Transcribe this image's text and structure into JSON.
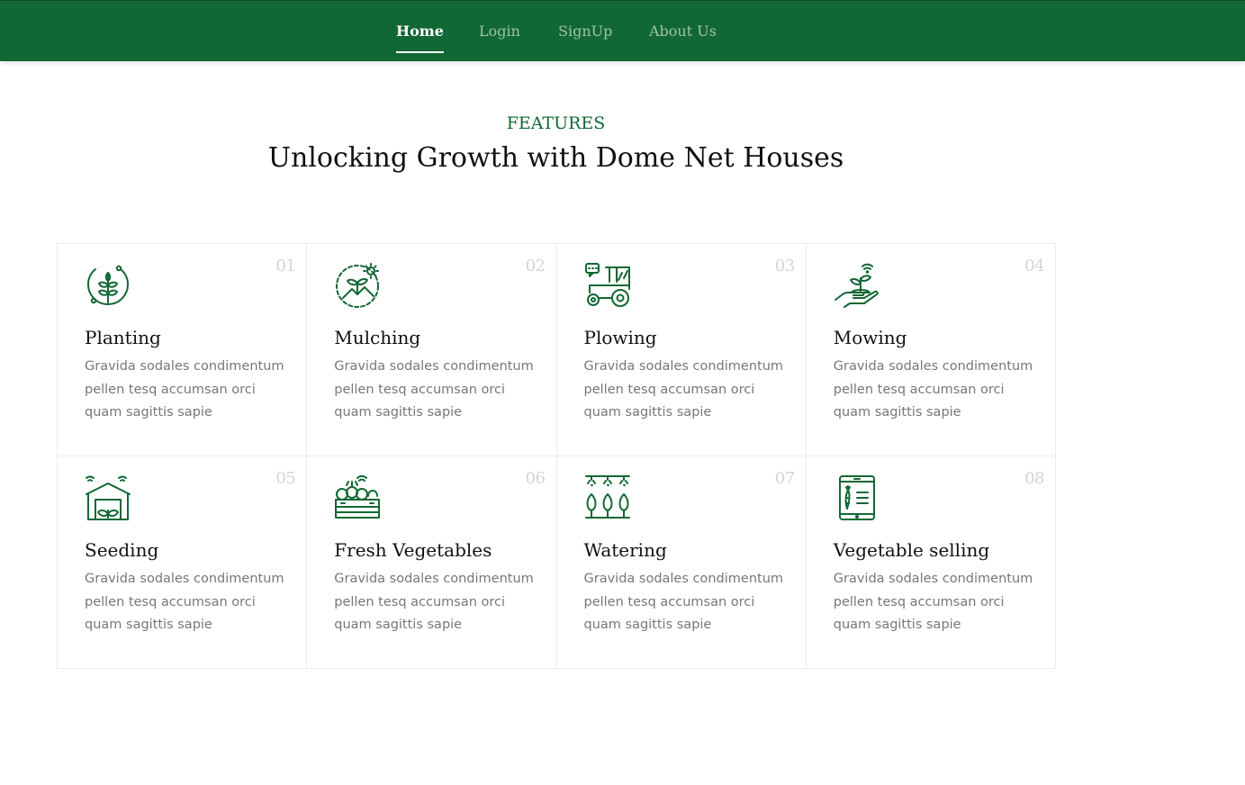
{
  "nav": {
    "home": "Home",
    "login": "Login",
    "signup": "SignUp",
    "about": "About Us",
    "active": "home"
  },
  "section": {
    "eyebrow": "FEATURES",
    "headline": "Unlocking Growth with Dome Net Houses"
  },
  "colors": {
    "brand_green": "#126835",
    "nav_link_inactive": "#9fc3a8",
    "title_text": "#111111",
    "body_text": "#777777",
    "number_text": "#d4d4d4"
  },
  "features": [
    {
      "number": "01",
      "title": "Planting",
      "icon": "plant-circle-icon",
      "description": "Gravida sodales condimentum pellen tesq accumsan orci quam sagittis sapie"
    },
    {
      "number": "02",
      "title": "Mulching",
      "icon": "seedling-sun-icon",
      "description": "Gravida sodales condimentum pellen tesq accumsan orci quam sagittis sapie"
    },
    {
      "number": "03",
      "title": "Plowing",
      "icon": "tractor-icon",
      "description": "Gravida sodales condimentum pellen tesq accumsan orci quam sagittis sapie"
    },
    {
      "number": "04",
      "title": "Mowing",
      "icon": "hand-sprout-icon",
      "description": "Gravida sodales condimentum pellen tesq accumsan orci quam sagittis sapie"
    },
    {
      "number": "05",
      "title": "Seeding",
      "icon": "greenhouse-icon",
      "description": "Gravida sodales condimentum pellen tesq accumsan orci quam sagittis sapie"
    },
    {
      "number": "06",
      "title": "Fresh Vegetables",
      "icon": "vegetable-crate-icon",
      "description": "Gravida sodales condimentum pellen tesq accumsan orci quam sagittis sapie"
    },
    {
      "number": "07",
      "title": "Watering",
      "icon": "sprinkler-trees-icon",
      "description": "Gravida sodales condimentum pellen tesq accumsan orci quam sagittis sapie"
    },
    {
      "number": "08",
      "title": "Vegetable selling",
      "icon": "tablet-carrot-icon",
      "description": "Gravida sodales condimentum pellen tesq accumsan orci quam sagittis sapie"
    }
  ]
}
